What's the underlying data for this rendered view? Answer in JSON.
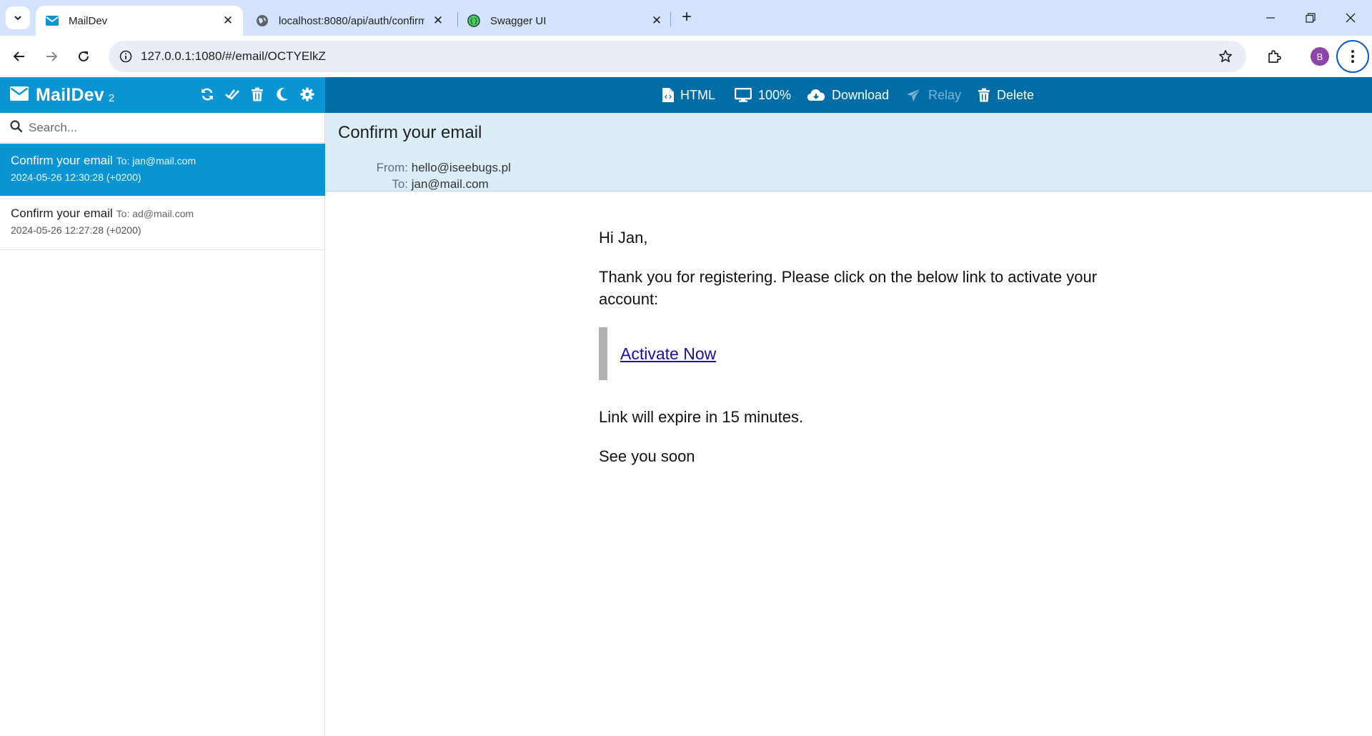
{
  "browser": {
    "tabs": [
      {
        "title": "MailDev",
        "icon": "envelope-icon",
        "active": true
      },
      {
        "title": "localhost:8080/api/auth/confirm",
        "icon": "globe-icon",
        "active": false
      },
      {
        "title": "Swagger UI",
        "icon": "swagger-icon",
        "active": false
      }
    ],
    "url": "127.0.0.1:1080/#/email/OCTYElkZ",
    "profile_initial": "B"
  },
  "app": {
    "name": "MailDev",
    "count": "2",
    "search_placeholder": "Search..."
  },
  "emails": [
    {
      "subject": "Confirm your email",
      "to": "To: jan@mail.com",
      "date": "2024-05-26 12:30:28 (+0200)",
      "selected": true
    },
    {
      "subject": "Confirm your email",
      "to": "To: ad@mail.com",
      "date": "2024-05-26 12:27:28 (+0200)",
      "selected": false
    }
  ],
  "toolbar": {
    "html": "HTML",
    "zoom": "100%",
    "download": "Download",
    "relay": "Relay",
    "delete": "Delete"
  },
  "message": {
    "subject": "Confirm your email",
    "from_label": "From:",
    "from": "hello@iseebugs.pl",
    "to_label": "To:",
    "to": "jan@mail.com",
    "greeting": "Hi Jan,",
    "para1": "Thank you for registering. Please click on the below link to activate your account:",
    "link": "Activate Now",
    "expire": "Link will expire in 15 minutes.",
    "closing": "See you soon"
  },
  "colors": {
    "maildev_blue": "#0995d3",
    "toolbar_blue": "#006da6",
    "header_bg": "#dbedf6",
    "tabstrip_bg": "#d3e3fd"
  }
}
